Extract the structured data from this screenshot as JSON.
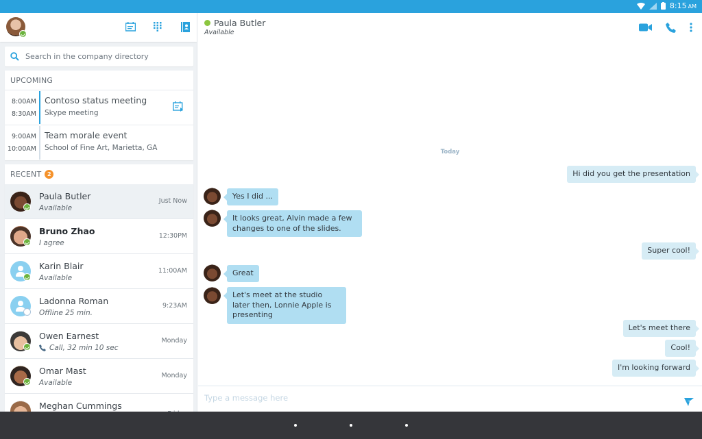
{
  "status_bar": {
    "time": "8:15",
    "ampm": "AM",
    "icons": [
      "wifi-icon",
      "signal-icon",
      "battery-icon"
    ]
  },
  "sidebar": {
    "header_icons": [
      "meetings-icon",
      "dialpad-icon",
      "contacts-icon"
    ],
    "search": {
      "placeholder": "Search in the company directory",
      "value": ""
    },
    "upcoming": {
      "title": "UPCOMING",
      "events": [
        {
          "start": "8:00AM",
          "end": "8:30AM",
          "title": "Contoso status meeting",
          "subtitle": "Skype meeting",
          "active": true,
          "join_icon": "join-meeting-icon"
        },
        {
          "start": "9:00AM",
          "end": "10:00AM",
          "title": "Team morale event",
          "subtitle": "School of Fine Art, Marietta, GA",
          "active": false
        }
      ]
    },
    "recent": {
      "title": "RECENT",
      "badge": "2",
      "contacts": [
        {
          "name": "Paula Butler",
          "status": "Available",
          "time": "Just Now",
          "presence": "available",
          "selected": true,
          "bold": false
        },
        {
          "name": "Bruno Zhao",
          "status": "I agree",
          "time": "12:30PM",
          "presence": "available",
          "selected": false,
          "bold": true
        },
        {
          "name": "Karin Blair",
          "status": "Available",
          "time": "11:00AM",
          "presence": "available",
          "selected": false,
          "bold": false,
          "generic": true
        },
        {
          "name": "Ladonna Roman",
          "status": "Offline 25 min.",
          "time": "9:23AM",
          "presence": "offline",
          "selected": false,
          "bold": false,
          "generic": true
        },
        {
          "name": "Owen Earnest",
          "status": "Call, 32 min 10 sec",
          "time": "Monday",
          "presence": "available",
          "selected": false,
          "bold": false,
          "status_icon": "phone-icon"
        },
        {
          "name": "Omar Mast",
          "status": "Available",
          "time": "Monday",
          "presence": "available",
          "selected": false,
          "bold": false
        },
        {
          "name": "Meghan Cummings",
          "status": "",
          "time": "Friday",
          "presence": "available",
          "selected": false,
          "bold": false
        }
      ]
    }
  },
  "chat": {
    "contact_name": "Paula Butler",
    "contact_status": "Available",
    "header_icons": [
      "video-call-icon",
      "phone-call-icon",
      "more-options-icon"
    ],
    "date_separator": "Today",
    "messages": [
      {
        "direction": "out",
        "text": "Hi did you get the presentation"
      },
      {
        "direction": "in",
        "text": "Yes I did ..."
      },
      {
        "direction": "in",
        "text": "It looks great, Alvin made a few changes to one of the slides."
      },
      {
        "direction": "out",
        "text": "Super cool!"
      },
      {
        "direction": "in",
        "text": "Great"
      },
      {
        "direction": "in",
        "text": "Let's meet at the studio later then, Lonnie Apple is presenting"
      },
      {
        "direction": "out",
        "text": "Let's meet there"
      },
      {
        "direction": "out",
        "text": "Cool!"
      },
      {
        "direction": "out",
        "text": "I'm looking forward"
      }
    ],
    "composer": {
      "placeholder": "Type a message here",
      "value": ""
    }
  },
  "colors": {
    "accent": "#2aa2dd",
    "available": "#6cb33e",
    "badge": "#f5922b",
    "incoming_bubble": "#b0def2",
    "outgoing_bubble": "#d6ecf5"
  }
}
